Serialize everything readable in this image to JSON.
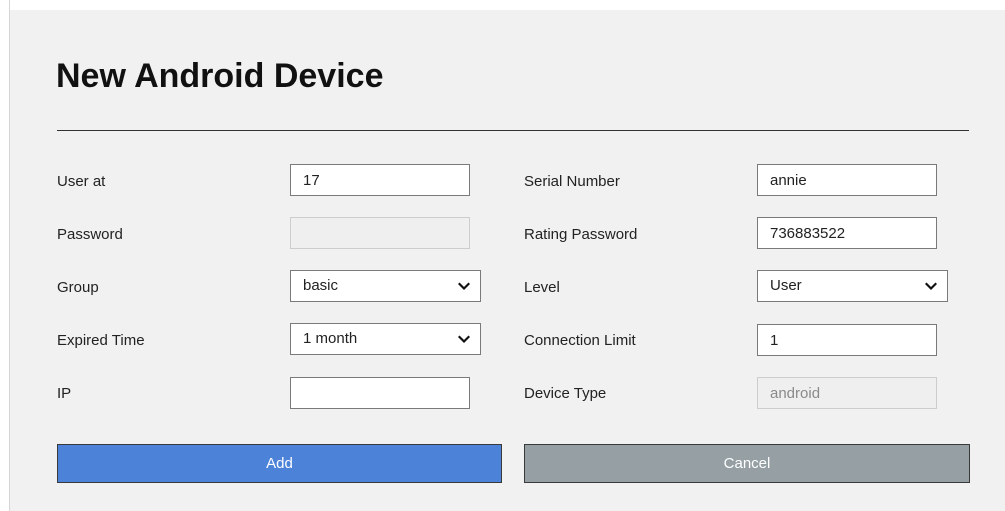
{
  "form": {
    "title": "New Android Device",
    "left": {
      "user_at": {
        "label": "User at",
        "value": "17"
      },
      "password": {
        "label": "Password",
        "value": ""
      },
      "group": {
        "label": "Group",
        "value": "basic"
      },
      "expired_time": {
        "label": "Expired Time",
        "value": "1 month"
      },
      "ip": {
        "label": "IP",
        "value": ""
      }
    },
    "right": {
      "serial_number": {
        "label": "Serial Number",
        "value": "annie"
      },
      "rating_password": {
        "label": "Rating Password",
        "value": "736883522"
      },
      "level": {
        "label": "Level",
        "value": "User"
      },
      "connection_limit": {
        "label": "Connection Limit",
        "value": "1"
      },
      "device_type": {
        "label": "Device Type",
        "value": "android"
      }
    },
    "buttons": {
      "add": "Add",
      "cancel": "Cancel"
    }
  },
  "colors": {
    "add_button": "#4d82d9",
    "cancel_button": "#959fa4",
    "panel_background": "#f1f1f1"
  }
}
